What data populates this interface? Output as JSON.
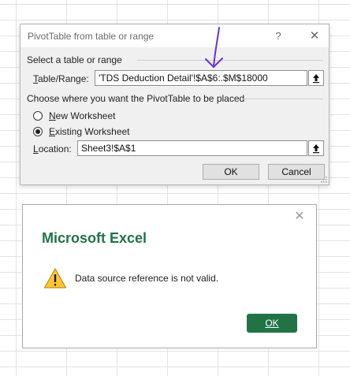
{
  "pivot_dialog": {
    "title": "PivotTable from table or range",
    "help_glyph": "?",
    "close_glyph": "✕",
    "select_section_label": "Select a table or range",
    "table_range": {
      "label_accel": "T",
      "label_rest": "able/Range:",
      "value": "'TDS Deduction Detail'!$A$6:.$M$18000"
    },
    "placement_section_label": "Choose where you want the PivotTable to be placed",
    "radio_new": {
      "accel": "N",
      "rest": "ew Worksheet",
      "checked": false
    },
    "radio_existing": {
      "accel": "E",
      "rest": "xisting Worksheet",
      "checked": true
    },
    "location": {
      "label_accel": "L",
      "label_rest": "ocation:",
      "value": "Sheet3!$A$1"
    },
    "ok_label": "OK",
    "cancel_label": "Cancel",
    "collapse_icon": "collapse-dialog-icon"
  },
  "annotation": {
    "color": "#6a2fd8",
    "icon": "arrow-down-annotation"
  },
  "message_box": {
    "close_glyph": "✕",
    "title": "Microsoft Excel",
    "title_color": "#217346",
    "icon": "warning-icon",
    "message": "Data source reference is not valid.",
    "ok_accel": "OK",
    "ok_color": "#217346"
  }
}
